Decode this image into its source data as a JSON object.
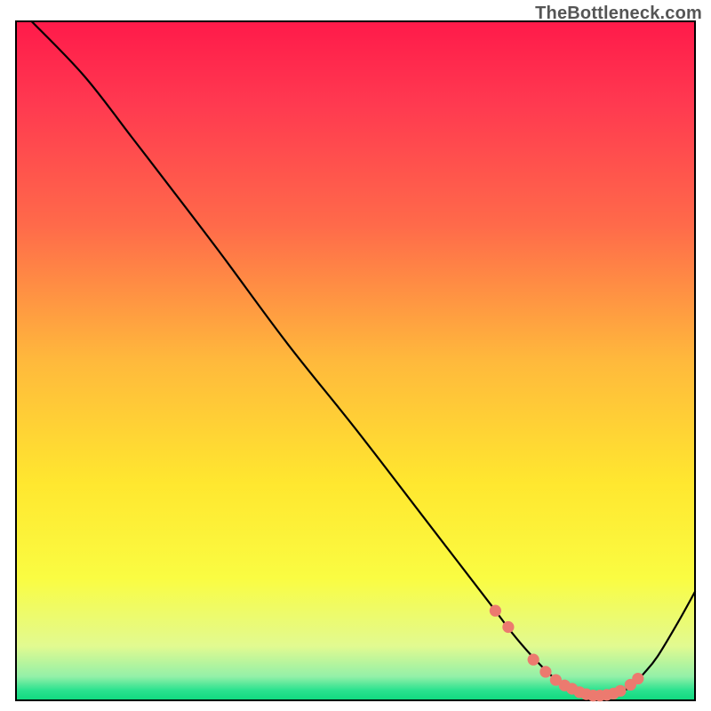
{
  "watermark": "TheBottleneck.com",
  "chart_data": {
    "type": "line",
    "title": "",
    "xlabel": "",
    "ylabel": "",
    "xlim": [
      0,
      100
    ],
    "ylim": [
      0,
      100
    ],
    "background_gradient": {
      "stops": [
        {
          "offset": 0.0,
          "color": "#ff1a4a"
        },
        {
          "offset": 0.12,
          "color": "#ff3950"
        },
        {
          "offset": 0.3,
          "color": "#ff6a4a"
        },
        {
          "offset": 0.5,
          "color": "#ffb93c"
        },
        {
          "offset": 0.68,
          "color": "#ffe72f"
        },
        {
          "offset": 0.82,
          "color": "#fafc42"
        },
        {
          "offset": 0.92,
          "color": "#e2fa90"
        },
        {
          "offset": 0.965,
          "color": "#93f0a8"
        },
        {
          "offset": 0.985,
          "color": "#2be28f"
        },
        {
          "offset": 1.0,
          "color": "#0fd97f"
        }
      ]
    },
    "series": [
      {
        "name": "bottleneck-curve",
        "x": [
          2.3,
          10.0,
          17.0,
          22.0,
          30.0,
          40.0,
          50.0,
          60.0,
          65.0,
          70.0,
          73.0,
          76.0,
          79.0,
          81.0,
          83.0,
          85.0,
          87.0,
          89.5,
          91.0,
          92.5,
          94.5,
          97.5,
          100.0
        ],
        "y": [
          100.0,
          92.0,
          83.0,
          76.5,
          66.0,
          52.5,
          40.0,
          27.0,
          20.5,
          14.0,
          10.0,
          6.5,
          3.5,
          2.0,
          1.0,
          0.5,
          0.6,
          1.4,
          2.5,
          4.0,
          6.5,
          11.5,
          16.0
        ]
      }
    ],
    "highlight_points": {
      "name": "optimal-range-markers",
      "x": [
        70.6,
        72.5,
        76.2,
        78.0,
        79.5,
        80.8,
        81.9,
        83.0,
        84.0,
        85.0,
        86.0,
        87.0,
        88.0,
        89.0,
        90.5,
        91.6
      ],
      "y": [
        13.2,
        10.8,
        6.0,
        4.2,
        3.0,
        2.2,
        1.7,
        1.2,
        0.9,
        0.7,
        0.7,
        0.8,
        1.0,
        1.4,
        2.3,
        3.2
      ]
    },
    "colors": {
      "curve": "#000000",
      "dot": "#ec7a6f"
    }
  }
}
